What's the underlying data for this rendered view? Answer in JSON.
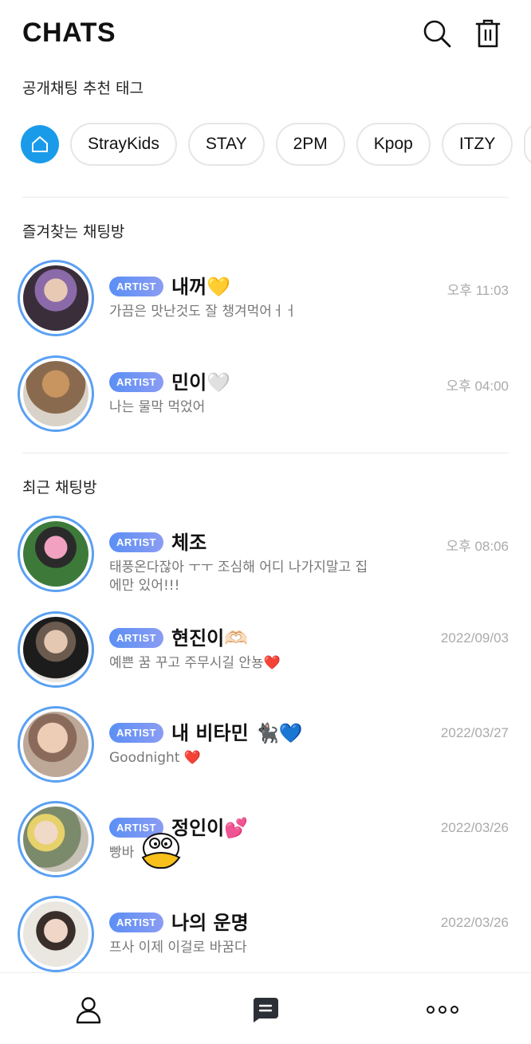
{
  "header": {
    "title": "CHATS",
    "search_icon": "search-icon",
    "trash_icon": "trash-icon"
  },
  "tags_section": {
    "label": "공개채팅 추천 태그",
    "home_icon": "home-icon",
    "tags": [
      "StrayKids",
      "STAY",
      "2PM",
      "Kpop",
      "ITZY"
    ]
  },
  "favorites": {
    "label": "즐겨찾는 채팅방",
    "rooms": [
      {
        "badge": "ARTIST",
        "name": "내꺼💛",
        "message": "가끔은 맛난것도 잘 챙겨먹어ㅓㅓ",
        "time": "오후 11:03"
      },
      {
        "badge": "ARTIST",
        "name": "민이🤍",
        "message": "나는 물막 먹었어",
        "time": "오후 04:00"
      }
    ]
  },
  "recent": {
    "label": "최근 채팅방",
    "rooms": [
      {
        "badge": "ARTIST",
        "name": "체조",
        "message": "태풍온다잖아 ㅜㅜ 조심해 어디 나가지말고 집에만 있어!!!",
        "time": "오후 08:06"
      },
      {
        "badge": "ARTIST",
        "name": "현진이🫶🏻",
        "message": "예쁜 꿈 꾸고 주무시길 안뇽❤️",
        "time": "2022/09/03"
      },
      {
        "badge": "ARTIST",
        "name": "내 비타민 🐈‍⬛💙",
        "message": "Goodnight ❤️",
        "time": "2022/03/27"
      },
      {
        "badge": "ARTIST",
        "name": "정인이💕",
        "message": "빵바",
        "time": "2022/03/26"
      },
      {
        "badge": "ARTIST",
        "name": "나의 운명",
        "message": "프사 이제 이걸로 바꿈다",
        "time": "2022/03/26"
      }
    ]
  },
  "bottom_nav": {
    "items": [
      "profile-icon",
      "chat-icon",
      "more-icon"
    ]
  },
  "colors": {
    "accent": "#1a9bea",
    "ring": "#5aa0f2",
    "badge_start": "#5b8ff5",
    "badge_end": "#8a9cf3"
  }
}
